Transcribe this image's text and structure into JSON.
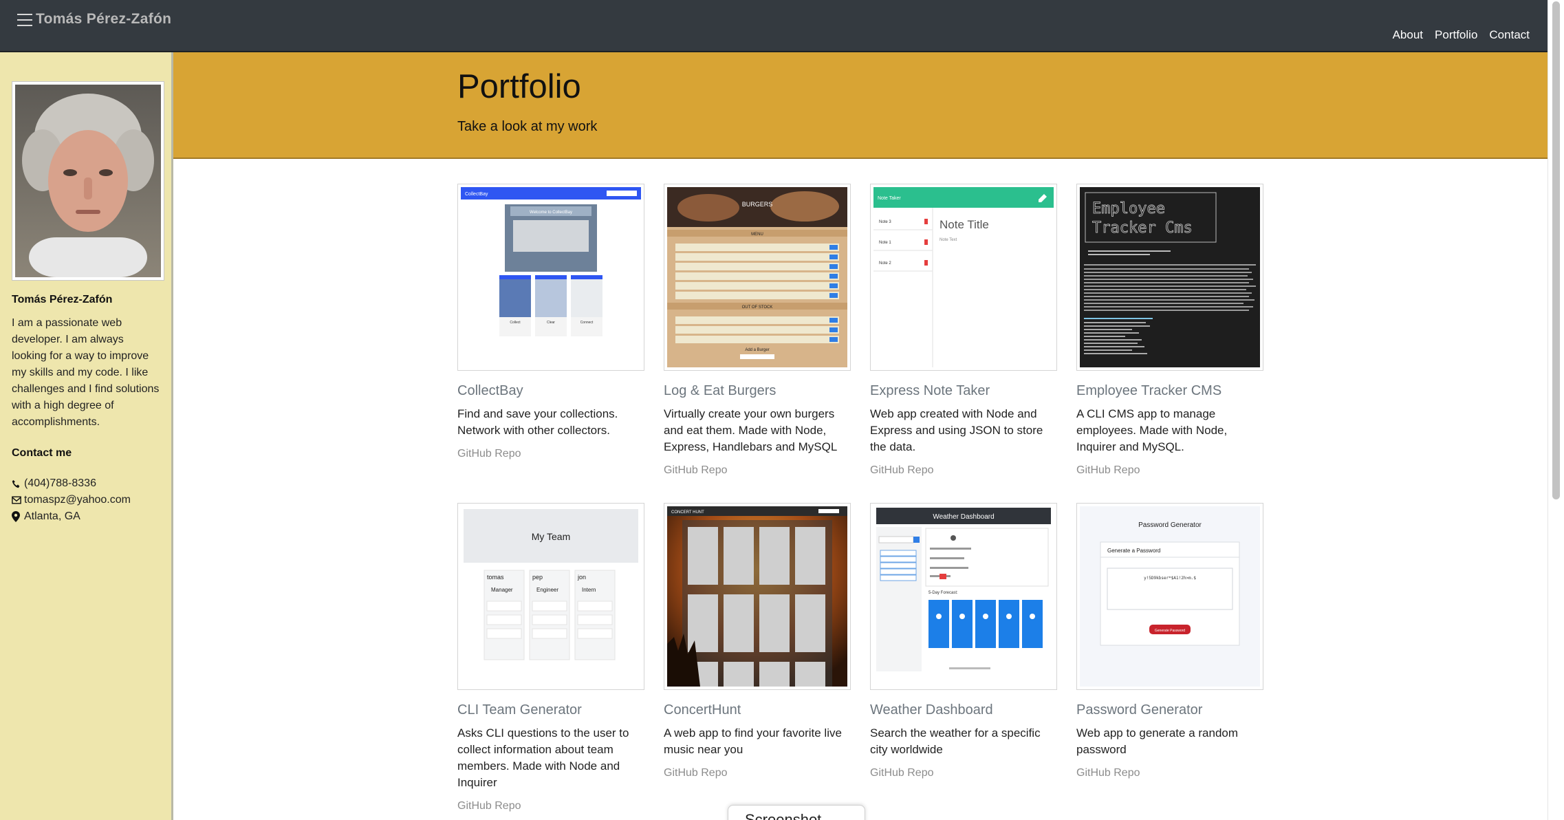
{
  "navbar": {
    "brand": "Tomás Pérez-Zafón",
    "links": [
      {
        "label": "About"
      },
      {
        "label": "Portfolio"
      },
      {
        "label": "Contact"
      }
    ]
  },
  "sidebar": {
    "name": "Tomás Pérez-Zafón",
    "bio": "I am a passionate web developer. I am always looking for a way to improve my skills and my code. I like challenges and I find solutions with a high degree of accomplishments.",
    "contact_heading": "Contact me",
    "phone": "(404)788-8336",
    "email": "tomaspz@yahoo.com",
    "location": "Atlanta, GA"
  },
  "hero": {
    "title": "Portfolio",
    "subtitle": "Take a look at my work"
  },
  "projects": [
    {
      "title": "CollectBay",
      "description": "Find and save your collections. Network with other collectors.",
      "link": "GitHub Repo"
    },
    {
      "title": "Log & Eat Burgers",
      "description": "Virtually create your own burgers and eat them. Made with Node, Express, Handlebars and MySQL",
      "link": "GitHub Repo"
    },
    {
      "title": "Express Note Taker",
      "description": "Web app created with Node and Express and using JSON to store the data.",
      "link": "GitHub Repo"
    },
    {
      "title": "Employee Tracker CMS",
      "description": "A CLI CMS app to manage employees. Made with Node, Inquirer and MySQL.",
      "link": "GitHub Repo"
    },
    {
      "title": "CLI Team Generator",
      "description": "Asks CLI questions to the user to collect information about team members. Made with Node and Inquirer",
      "link": "GitHub Repo"
    },
    {
      "title": "ConcertHunt",
      "description": "A web app to find your favorite live music near you",
      "link": "GitHub Repo"
    },
    {
      "title": "Weather Dashboard",
      "description": "Search the weather for a specific city worldwide",
      "link": "GitHub Repo"
    },
    {
      "title": "Password Generator",
      "description": "Web app to generate a random password",
      "link": "GitHub Repo"
    }
  ],
  "thumbnails": {
    "collectbay": {
      "brand": "CollectBay",
      "banner": "Welcome to CollectBay",
      "cards": [
        "Collect",
        "Clear",
        "Connect"
      ]
    },
    "burgers": {
      "header": "BURGERS",
      "menu": "MENU",
      "out_of_stock": "OUT OF STOCK",
      "add": "Add a Burger"
    },
    "notes": {
      "app": "Note Taker",
      "title": "Note Title",
      "text": "Note Text",
      "items": [
        "Note 3",
        "Note 1",
        "Note 2"
      ]
    },
    "employee": {
      "banner": [
        "Employee",
        "Tracker Cms"
      ]
    },
    "team": {
      "header": "My Team",
      "members": [
        {
          "name": "tomas",
          "role": "Manager"
        },
        {
          "name": "pep",
          "role": "Engineer"
        },
        {
          "name": "jon",
          "role": "Intern"
        }
      ]
    },
    "concert": {
      "brand": "CONCERT HUNT"
    },
    "weather": {
      "header": "Weather Dashboard",
      "forecast": "5-Day Forecast:"
    },
    "password": {
      "title": "Password Generator",
      "card_title": "Generate a Password",
      "sample": "y!5D9kbser*$A1!2h>m.$",
      "button": "Generate Password"
    }
  },
  "floating": {
    "label": "Screenshot"
  },
  "colors": {
    "navbar": "#343a40",
    "sidebar": "#eee6ad",
    "hero": "#d8a434",
    "muted_text": "#6c757d"
  }
}
